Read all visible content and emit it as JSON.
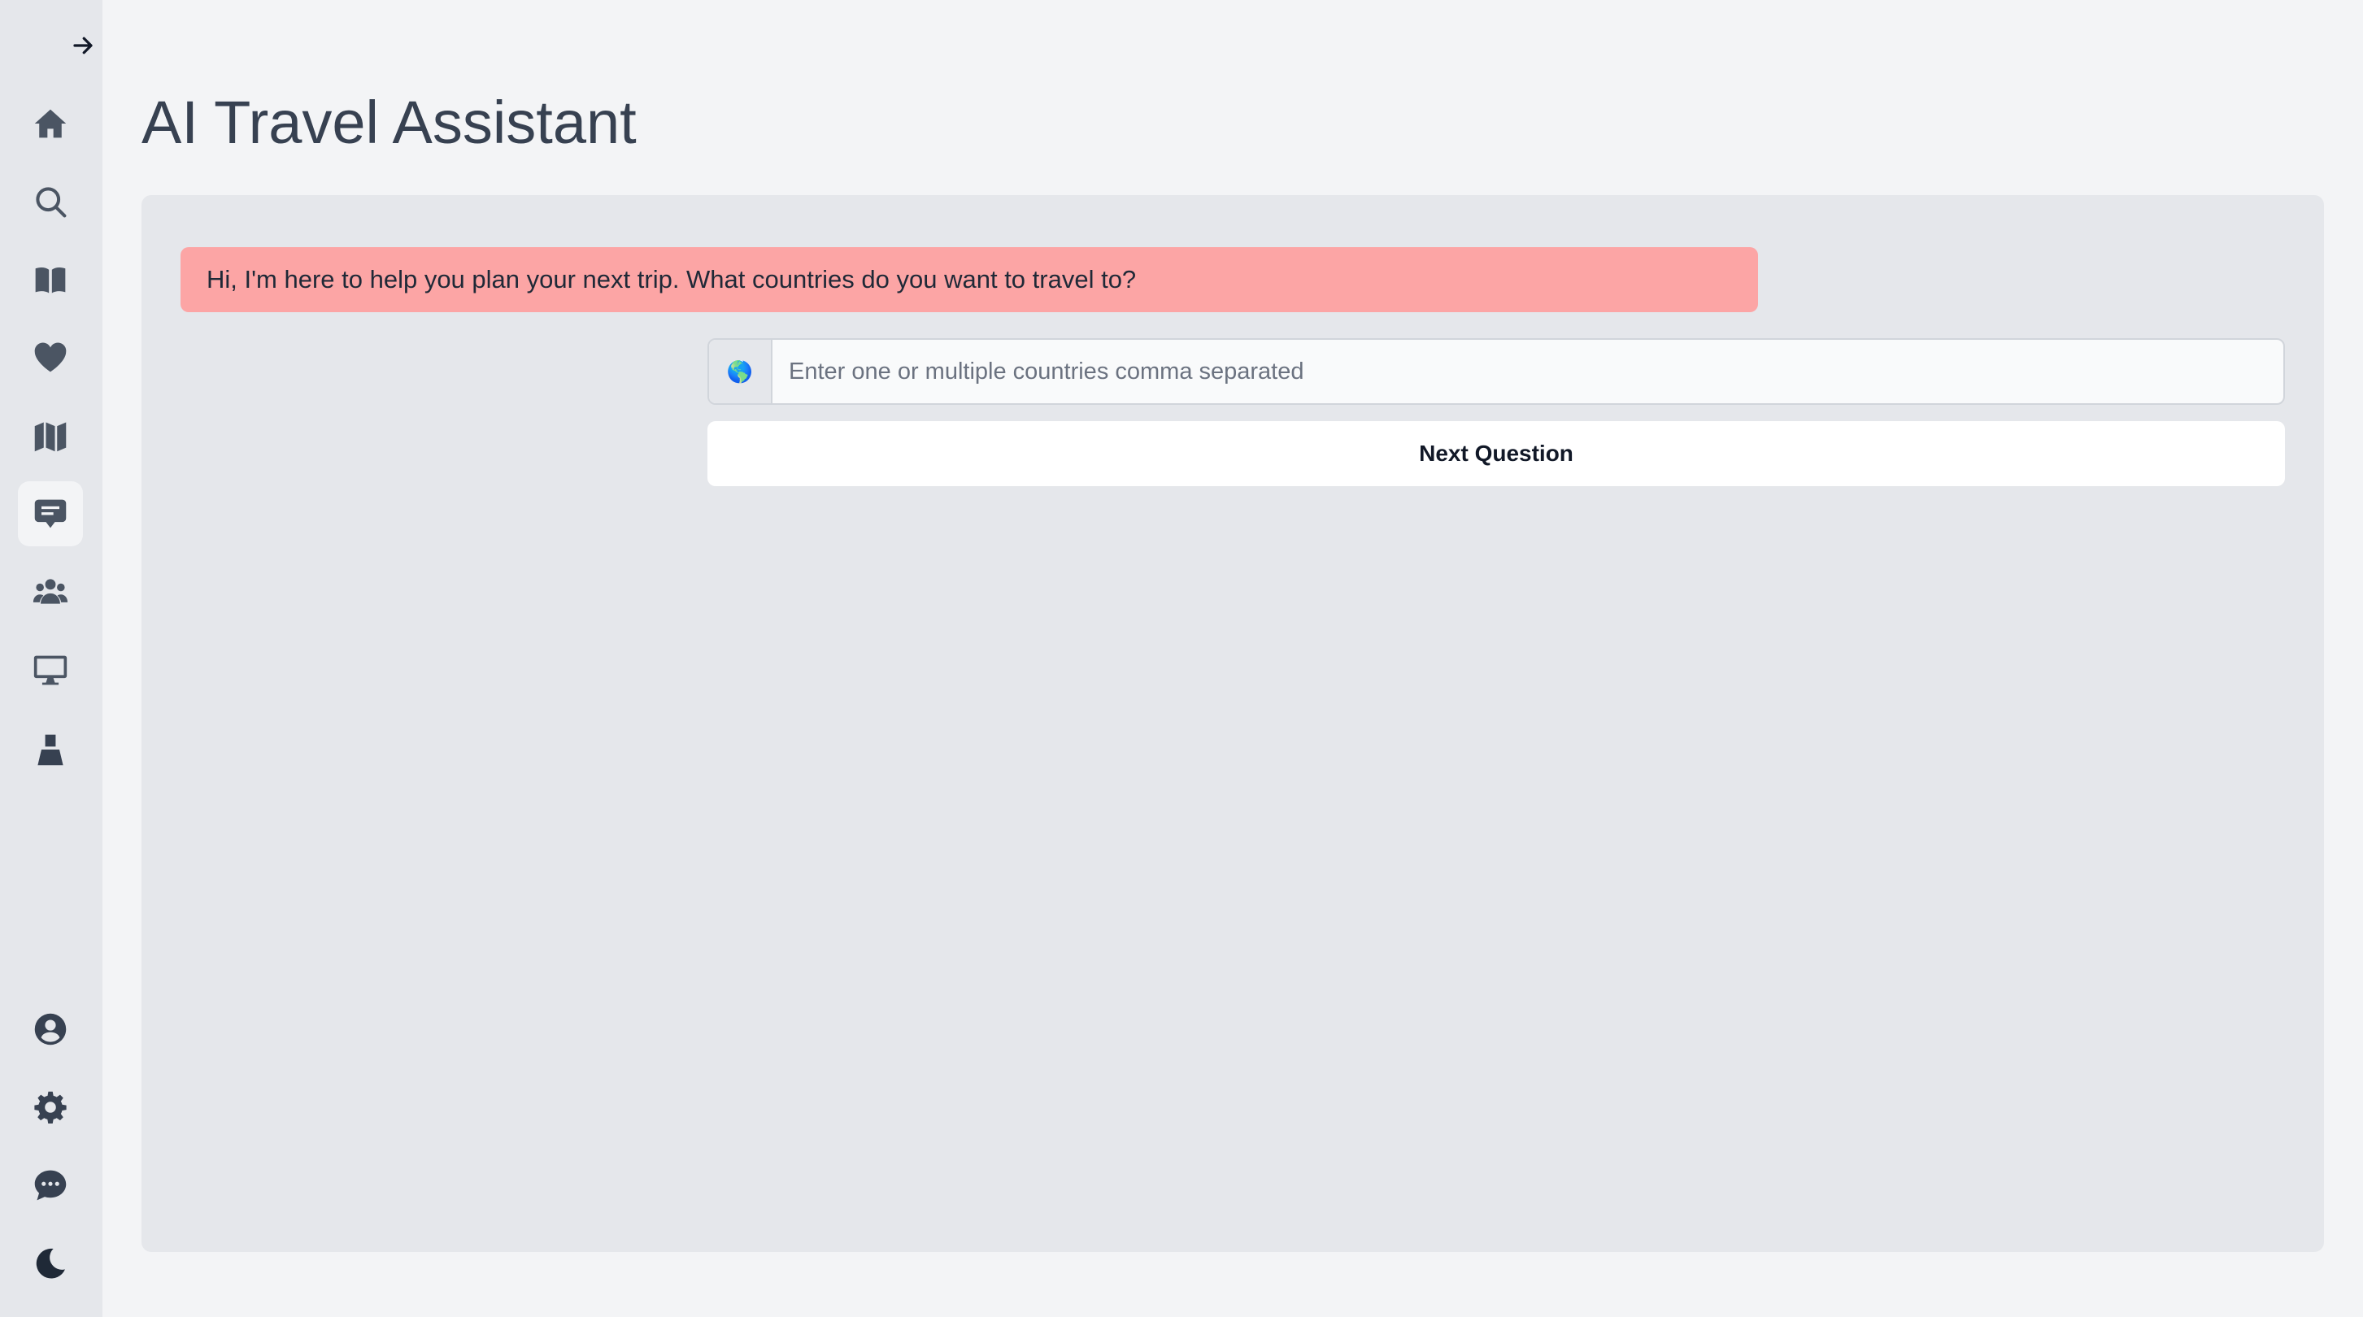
{
  "app": {
    "title": "AI Travel Assistant"
  },
  "sidebar": {
    "top_items": [
      {
        "icon": "home-icon"
      },
      {
        "icon": "search-icon"
      },
      {
        "icon": "book-icon"
      },
      {
        "icon": "heart-icon"
      },
      {
        "icon": "map-icon"
      },
      {
        "icon": "chat-icon",
        "active": true
      },
      {
        "icon": "users-icon"
      },
      {
        "icon": "monitor-icon"
      },
      {
        "icon": "user-silhouette-icon"
      }
    ],
    "bottom_items": [
      {
        "icon": "profile-icon"
      },
      {
        "icon": "gear-icon"
      },
      {
        "icon": "feedback-icon"
      },
      {
        "icon": "moon-icon"
      }
    ]
  },
  "chat": {
    "assistant_message": "Hi, I'm here to help you plan your next trip. What countries do you want to travel to?",
    "input": {
      "addon_icon": "🌎",
      "value": "",
      "placeholder": "Enter one or multiple countries comma separated"
    },
    "next_button_label": "Next Question"
  },
  "colors": {
    "assistant_bubble": "#fca5a5",
    "panel": "#e5e7eb",
    "background": "#f3f4f6"
  }
}
